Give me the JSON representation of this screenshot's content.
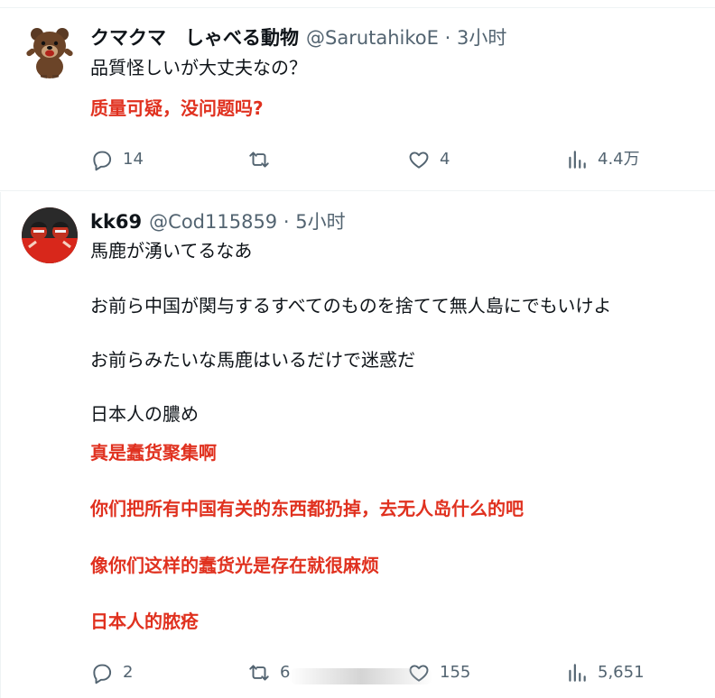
{
  "tweets": [
    {
      "name": "クマクマ　しゃべる動物",
      "handle": "@SarutahikoE",
      "dot": "·",
      "time": "3小时",
      "text_jp": [
        "品質怪しいが大丈夫なの？"
      ],
      "text_cn": [
        "质量可疑，没问题吗?"
      ],
      "stats": {
        "replies": "14",
        "retweets": "",
        "likes": "4",
        "views": "4.4万"
      }
    },
    {
      "name": "kk69",
      "handle": "@Cod115859",
      "dot": "·",
      "time": "5小时",
      "text_jp": [
        "馬鹿が湧いてるなあ",
        "お前ら中国が関与するすべてのものを捨てて無人島にでもいけよ",
        "お前らみたいな馬鹿はいるだけで迷惑だ",
        "日本人の膿め"
      ],
      "text_cn": [
        "真是蠢货聚集啊",
        "你们把所有中国有关的东西都扔掉，去无人岛什么的吧",
        "像你们这样的蠢货光是存在就很麻烦",
        "日本人的脓疮"
      ],
      "stats": {
        "replies": "2",
        "retweets": "6",
        "likes": "155",
        "views": "5,651"
      }
    }
  ],
  "icons": {
    "reply": "reply-icon",
    "retweet": "retweet-icon",
    "like": "heart-icon",
    "views": "views-icon"
  },
  "colors": {
    "translation": "#e0311f",
    "muted": "#536471",
    "text": "#0f1419"
  }
}
